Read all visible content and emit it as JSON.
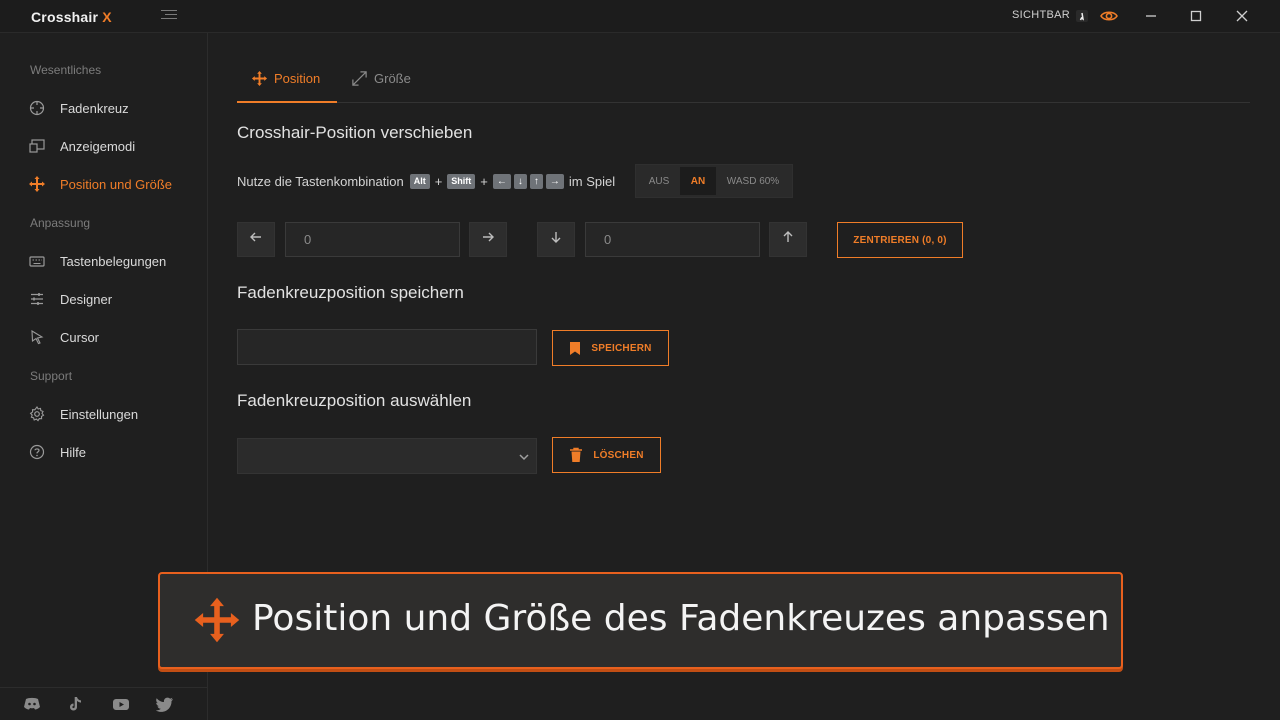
{
  "window": {
    "title_main": "Crosshair",
    "title_accent": "X",
    "visibility_label": "SICHTBAR"
  },
  "sidebar": {
    "sections": [
      "Wesentliches",
      "Anpassung",
      "Support"
    ],
    "items": [
      {
        "label": "Fadenkreuz",
        "icon": "crosshair-icon"
      },
      {
        "label": "Anzeigemodi",
        "icon": "monitor-icon"
      },
      {
        "label": "Position und Größe",
        "icon": "move-icon"
      },
      {
        "label": "Tastenbelegungen",
        "icon": "keyboard-icon"
      },
      {
        "label": "Designer",
        "icon": "sliders-icon"
      },
      {
        "label": "Cursor",
        "icon": "cursor-icon"
      },
      {
        "label": "Einstellungen",
        "icon": "gear-icon"
      },
      {
        "label": "Hilfe",
        "icon": "help-icon"
      }
    ],
    "social": [
      "discord-icon",
      "tiktok-icon",
      "youtube-icon",
      "twitter-icon"
    ]
  },
  "tabs": [
    {
      "label": "Position"
    },
    {
      "label": "Größe"
    }
  ],
  "move": {
    "title": "Crosshair-Position verschieben",
    "hint_prefix": "Nutze die Tastenkombination",
    "key_alt": "Alt",
    "key_shift": "Shift",
    "plus": "+",
    "arrow_left": "←",
    "arrow_down": "↓",
    "arrow_up": "↑",
    "arrow_right": "→",
    "hint_suffix": "im Spiel",
    "mode_options": [
      "AUS",
      "AN",
      "WASD 60%"
    ],
    "mode_selected": "AN",
    "x_value": "0",
    "y_value": "0",
    "center_button": "ZENTRIEREN (0, 0)"
  },
  "save": {
    "title": "Fadenkreuzposition speichern",
    "input_value": "",
    "button": "SPEICHERN"
  },
  "select": {
    "title": "Fadenkreuzposition auswählen",
    "selected": "",
    "button": "LÖSCHEN"
  },
  "banner": {
    "text": "Position und Größe des Fadenkreuzes anpassen"
  },
  "colors": {
    "accent": "#f07d28",
    "background": "#1f1f1f",
    "banner_border": "#e8601e"
  }
}
